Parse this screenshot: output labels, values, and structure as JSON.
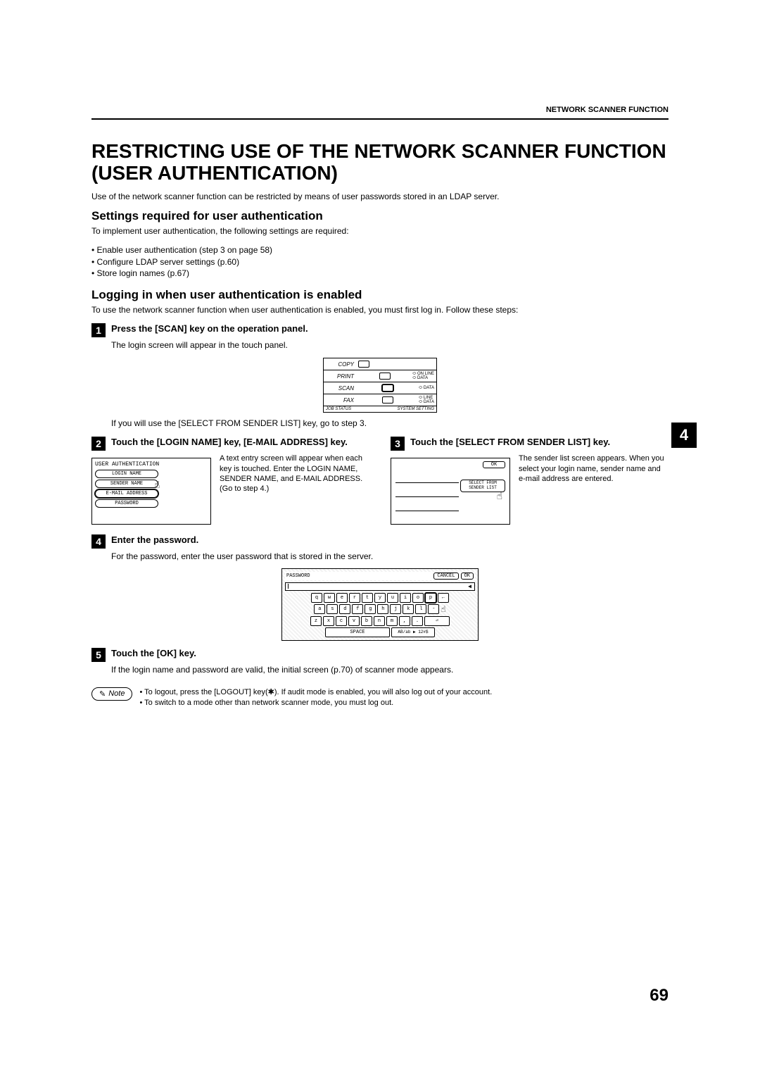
{
  "header_label": "NETWORK SCANNER FUNCTION",
  "title": "RESTRICTING USE OF THE NETWORK SCANNER FUNCTION (USER AUTHENTICATION)",
  "intro": "Use of the network scanner function can be restricted by means of user passwords stored in an LDAP server.",
  "section1_title": "Settings required for user authentication",
  "section1_intro": "To implement user authentication, the following settings are required:",
  "bullets": [
    "• Enable user authentication (step 3 on page 58)",
    "• Configure LDAP server settings (p.60)",
    "• Store login names (p.67)"
  ],
  "section2_title": "Logging in when user authentication is enabled",
  "section2_intro": "To use the network scanner function when user authentication is enabled, you must first log in. Follow these steps:",
  "step1": {
    "num": "1",
    "title": "Press the [SCAN] key on the operation panel.",
    "desc": "The login screen will appear in the touch panel.",
    "after": "If you will use the [SELECT FROM SENDER LIST] key, go to step 3."
  },
  "panel": {
    "rows": [
      "COPY",
      "PRINT",
      "SCAN",
      "FAX"
    ],
    "leds": {
      "print": [
        "ON LINE",
        "DATA"
      ],
      "scan": [
        "DATA"
      ],
      "fax": [
        "LINE",
        "DATA"
      ]
    },
    "bottom_left": "JOB STATUS",
    "bottom_right": "SYSTEM SETTING"
  },
  "step2": {
    "num": "2",
    "title": "Touch the [LOGIN NAME] key, [E-MAIL ADDRESS] key.",
    "text": "A text entry screen will appear when each key is touched. Enter the LOGIN NAME, SENDER NAME, and E-MAIL ADDRESS. (Go to step 4.)",
    "diagram_title": "USER AUTHENTICATION",
    "buttons": [
      "LOGIN NAME",
      "SENDER NAME",
      "E-MAIL ADDRESS",
      "PASSWORD"
    ]
  },
  "step3": {
    "num": "3",
    "title": "Touch the [SELECT FROM SENDER LIST] key.",
    "text": "The sender list screen appears. When you select your login name, sender name and e-mail address are entered.",
    "ok": "OK",
    "btn": "SELECT FROM SENDER LIST"
  },
  "step4": {
    "num": "4",
    "title": "Enter the password.",
    "desc": "For the password, enter the user password that is stored in the server.",
    "kb_title": "PASSWORD",
    "cancel": "CANCEL",
    "ok": "OK",
    "keys_r1": [
      "q",
      "w",
      "e",
      "r",
      "t",
      "y",
      "u",
      "i",
      "o",
      "p"
    ],
    "keys_r2": [
      "a",
      "s",
      "d",
      "f",
      "g",
      "h",
      "j",
      "k",
      "l"
    ],
    "keys_r3": [
      "z",
      "x",
      "c",
      "v",
      "b",
      "n",
      "m"
    ],
    "space": "SPACE",
    "mode": "AB/ab ▶ 12#$"
  },
  "step5": {
    "num": "5",
    "title": "Touch the [OK] key.",
    "desc": "If the login name and password are valid, the initial screen (p.70) of scanner mode appears."
  },
  "note_label": "Note",
  "note_lines": [
    "• To logout, press the [LOGOUT] key(✱). If audit mode is enabled, you will also log out of your account.",
    "• To switch to a mode other than network scanner mode, you must log out."
  ],
  "chapter": "4",
  "page_num": "69"
}
